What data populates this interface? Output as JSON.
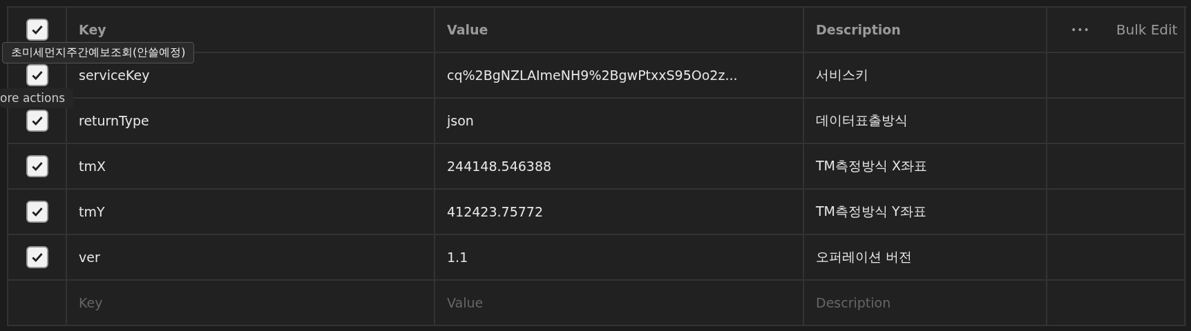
{
  "table": {
    "header": {
      "checked": true,
      "columns": [
        "Key",
        "Value",
        "Description"
      ],
      "more_actions": "•••",
      "bulk_edit": "Bulk Edit"
    },
    "rows": [
      {
        "checked": true,
        "key": "serviceKey",
        "value": "cq%2BgNZLAImeNH9%2BgwPtxxS95Oo2z...",
        "description": "서비스키"
      },
      {
        "checked": true,
        "key": "returnType",
        "value": "json",
        "description": "데이터표출방식"
      },
      {
        "checked": true,
        "key": "tmX",
        "value": "244148.546388",
        "description": "TM측정방식 X좌표"
      },
      {
        "checked": true,
        "key": "tmY",
        "value": "412423.75772",
        "description": "TM측정방식 Y좌표"
      },
      {
        "checked": true,
        "key": "ver",
        "value": "1.1",
        "description": "오퍼레이션 버전"
      }
    ],
    "new_row": {
      "key_placeholder": "Key",
      "value_placeholder": "Value",
      "description_placeholder": "Description"
    }
  },
  "tooltips": [
    "초미세먼지주간예보조회(안쓸예정)",
    "ore actions"
  ]
}
